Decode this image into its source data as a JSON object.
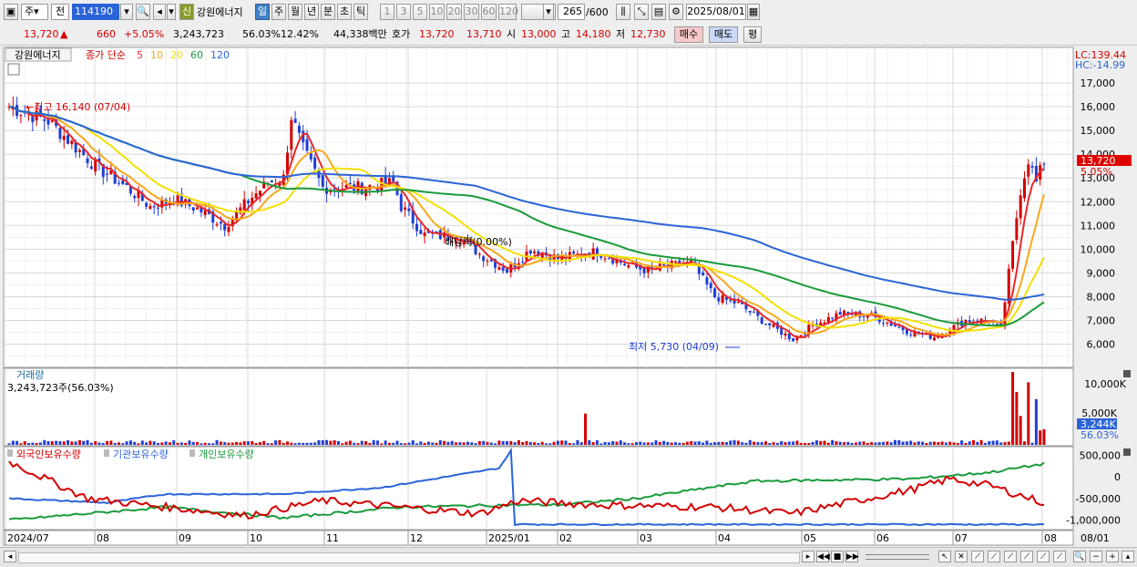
{
  "toolbar": {
    "period_sel": "주",
    "prev_label": "전",
    "code": "114190",
    "shin": "신",
    "stock_name": "강원에너지",
    "period_buttons": [
      "일",
      "주",
      "월",
      "년",
      "분",
      "초",
      "틱"
    ],
    "num_buttons": [
      "1",
      "3",
      "5",
      "10",
      "20",
      "30",
      "60",
      "120"
    ],
    "count": "265",
    "count_max": "/600",
    "date": "2025/08/01"
  },
  "quote": {
    "price": "13,720",
    "arrow": "▲",
    "change": "660",
    "change_pct": "+5.05%",
    "volume": "3,243,723",
    "vol_ratio": "56.03%",
    "turnover": "12.42%",
    "amount": "44,338백만",
    "hoga_label": "호가",
    "ask": "13,720",
    "bid": "13,710",
    "open_label": "시",
    "open": "13,000",
    "high_label": "고",
    "high": "14,180",
    "low_label": "저",
    "low": "12,730",
    "buy": "매수",
    "sell": "매도",
    "eval": "평"
  },
  "legend": {
    "name": "강원에너지",
    "prefix": "종가 단순",
    "ma": [
      {
        "label": "5",
        "color": "#e8262a"
      },
      {
        "label": "10",
        "color": "#f7a81b"
      },
      {
        "label": "20",
        "color": "#f2e000"
      },
      {
        "label": "60",
        "color": "#1a9a3b"
      },
      {
        "label": "120",
        "color": "#2b63d8"
      }
    ]
  },
  "price_chart": {
    "lc": "LC:139.44",
    "hc": "HC:-14.99",
    "price_tag": "13,720",
    "pct_tag": "5.05%",
    "high_annot": "최고 16,140 (07/04)",
    "low_annot": "최저 5,730 (04/09)",
    "div_annot": "배당락(0.00%)",
    "yticks": [
      "17,000",
      "16,000",
      "15,000",
      "14,000",
      "13,000",
      "12,000",
      "11,000",
      "10,000",
      "9,000",
      "8,000",
      "7,000",
      "6,000"
    ]
  },
  "volume_chart": {
    "title": "거래량",
    "value": "3,243,723주(56.03%)",
    "yticks": [
      "10,000K",
      "5,000K"
    ],
    "tag": "3,244K",
    "tag_pct": "56.03%"
  },
  "holding_chart": {
    "series": [
      {
        "name": "외국인보유수량",
        "color": "#d40000"
      },
      {
        "name": "기관보유수량",
        "color": "#2b63d8"
      },
      {
        "name": "개인보유수량",
        "color": "#1a9a3b"
      }
    ],
    "yticks": [
      "500,000",
      "0",
      "-500,000",
      "-1,000,000"
    ]
  },
  "xaxis": [
    "2024/07",
    "08",
    "09",
    "10",
    "11",
    "12",
    "2025/01",
    "02",
    "03",
    "04",
    "05",
    "06",
    "07",
    "08"
  ],
  "xaxis_right": "08/01",
  "colors": {
    "up": "#d40000",
    "down": "#1f3fd6",
    "grid": "#d4d4d4"
  }
}
